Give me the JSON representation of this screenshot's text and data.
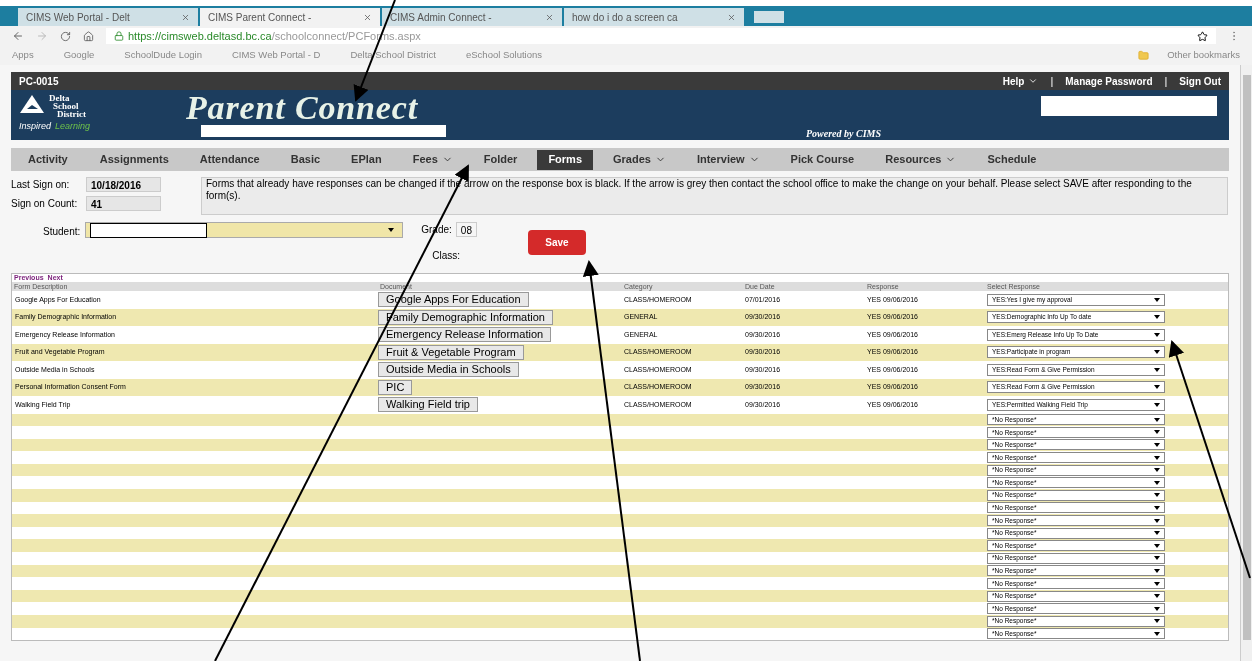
{
  "browser": {
    "tabs": [
      {
        "title": "CIMS Web Portal - Delt",
        "selected": false
      },
      {
        "title": "CIMS Parent Connect - ",
        "selected": true
      },
      {
        "title": "CIMS Admin Connect - ",
        "selected": false
      },
      {
        "title": "how do i do a screen ca",
        "selected": false
      }
    ],
    "url_host": "https://cimsweb.deltasd.bc.ca",
    "url_path": "/schoolconnect/PCForms.aspx",
    "bookmarks": [
      "Apps",
      "Google",
      "SchoolDude Login",
      "CIMS Web Portal - D",
      "Delta School District",
      "eSchool Solutions"
    ],
    "other_bookmarks": "Other bookmarks"
  },
  "page": {
    "site_id": "PC-0015",
    "top_links": [
      "Help",
      "Manage Password",
      "Sign Out"
    ],
    "top_link_separators": [
      "|",
      "|"
    ],
    "logo": {
      "lines": [
        "Delta",
        "School",
        "District"
      ],
      "tagline_a": "Inspired",
      "tagline_b": "Learning"
    },
    "title": "Parent Connect",
    "powered_by": "Powered by CIMS",
    "nav": [
      {
        "label": "Activity",
        "dropdown": false,
        "selected": false
      },
      {
        "label": "Assignments",
        "dropdown": false,
        "selected": false
      },
      {
        "label": "Attendance",
        "dropdown": false,
        "selected": false
      },
      {
        "label": "Basic",
        "dropdown": false,
        "selected": false
      },
      {
        "label": "EPlan",
        "dropdown": false,
        "selected": false
      },
      {
        "label": "Fees",
        "dropdown": true,
        "selected": false
      },
      {
        "label": "Folder",
        "dropdown": false,
        "selected": false
      },
      {
        "label": "Forms",
        "dropdown": false,
        "selected": true
      },
      {
        "label": "Grades",
        "dropdown": true,
        "selected": false
      },
      {
        "label": "Interview",
        "dropdown": true,
        "selected": false
      },
      {
        "label": "Pick Course",
        "dropdown": false,
        "selected": false
      },
      {
        "label": "Resources",
        "dropdown": true,
        "selected": false
      },
      {
        "label": "Schedule",
        "dropdown": false,
        "selected": false
      }
    ],
    "last_sign_on": {
      "label": "Last Sign on:",
      "value": "10/18/2016"
    },
    "sign_on_count": {
      "label": "Sign on Count:",
      "value": "41"
    },
    "message": "Forms that already have responses can be changed if the arrow on the response box is black. If the arrow is grey then contact the school office to make the change on your behalf. Please select SAVE after responding to the form(s).",
    "student_label": "Student:",
    "grade_label": "Grade:",
    "grade_value": "08",
    "class_label": "Class:",
    "save": "Save",
    "pager": [
      "Previous",
      "Next"
    ],
    "columns": [
      "Form Description",
      "Document",
      "Category",
      "Due Date",
      "Response",
      "Select Response"
    ],
    "rows": [
      {
        "description": "Google Apps For Education",
        "document": "Google Apps For Education",
        "category": "CLASS/HOMEROOM",
        "due_date": "07/01/2016",
        "response": "YES 09/06/2016",
        "select_response": "YES:Yes I give my approval"
      },
      {
        "description": "Family Demographic Information",
        "document": "Family Demographic Information",
        "category": "GENERAL",
        "due_date": "09/30/2016",
        "response": "YES 09/06/2016",
        "select_response": "YES:Demographic Info Up To date"
      },
      {
        "description": "Emergency Release Information",
        "document": "Emergency Release Information",
        "category": "GENERAL",
        "due_date": "09/30/2016",
        "response": "YES 09/06/2016",
        "select_response": "YES:Emerg Release Info Up To Date"
      },
      {
        "description": "Fruit and Vegetable Program",
        "document": "Fruit & Vegetable Program",
        "category": "CLASS/HOMEROOM",
        "due_date": "09/30/2016",
        "response": "YES 09/06/2016",
        "select_response": "YES:Participate in program"
      },
      {
        "description": "Outside Media in Schools",
        "document": "Outside Media in Schools",
        "category": "CLASS/HOMEROOM",
        "due_date": "09/30/2016",
        "response": "YES 09/06/2016",
        "select_response": "YES:Read Form & Give Permission"
      },
      {
        "description": "Personal Information Consent Form",
        "document": "PIC",
        "category": "CLASS/HOMEROOM",
        "due_date": "09/30/2016",
        "response": "YES 09/06/2016",
        "select_response": "YES:Read Form & Give Permission"
      },
      {
        "description": "Walking Field Trip",
        "document": "Walking Field trip",
        "category": "CLASS/HOMEROOM",
        "due_date": "09/30/2016",
        "response": "YES 09/06/2016",
        "select_response": "YES:Permitted Walking Field Trip"
      }
    ],
    "empty_rows": [
      "*No Response*",
      "*No Response*",
      "*No Response*",
      "*No Response*",
      "*No Response*",
      "*No Response*",
      "*No Response*",
      "*No Response*",
      "*No Response*",
      "*No Response*",
      "*No Response*",
      "*No Response*",
      "*No Response*",
      "*No Response*",
      "*No Response*",
      "*No Response*",
      "*No Response*",
      "*No Response*"
    ]
  }
}
